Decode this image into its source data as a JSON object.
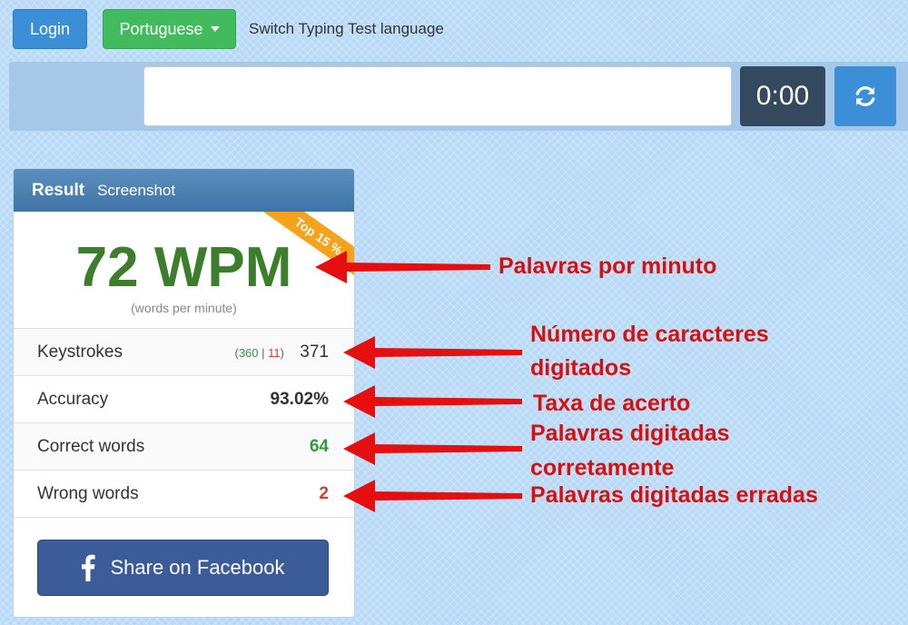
{
  "header": {
    "login_label": "Login",
    "language_label": "Portuguese",
    "switch_text": "Switch Typing Test language"
  },
  "test": {
    "input_value": "",
    "timer": "0:00",
    "reload_icon": "refresh-icon"
  },
  "result": {
    "tabs": [
      "Result",
      "Screenshot"
    ],
    "badge": "Top 15 %",
    "wpm": "72 WPM",
    "wpm_subtitle": "(words per minute)",
    "keystrokes": {
      "label": "Keystrokes",
      "correct": "360",
      "sep": "|",
      "wrong": "11",
      "total": "371"
    },
    "accuracy": {
      "label": "Accuracy",
      "value": "93.02%"
    },
    "correct_words": {
      "label": "Correct words",
      "value": "64"
    },
    "wrong_words": {
      "label": "Wrong words",
      "value": "2"
    },
    "share_label": "Share on Facebook"
  },
  "annotations": {
    "wpm": "Palavras por minuto",
    "keystrokes_line1": "Número de caracteres",
    "keystrokes_line2": "digitados",
    "accuracy": "Taxa de acerto",
    "correct_line1": "Palavras digitadas",
    "correct_line2": "corretamente",
    "wrong": "Palavras digitadas erradas"
  },
  "colors": {
    "wpm_green": "#3c7e2c",
    "annotation_red": "#d60f0f",
    "badge_orange": "#f7a21b",
    "facebook_blue": "#3b5b99"
  }
}
